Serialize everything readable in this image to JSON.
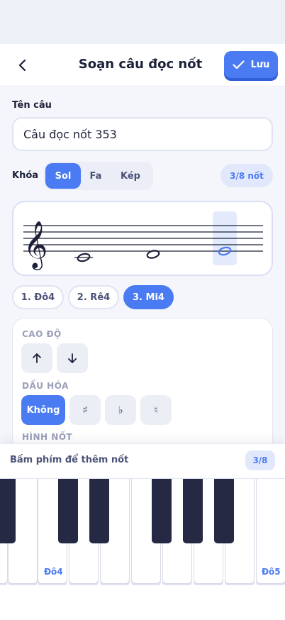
{
  "header": {
    "title": "Soạn câu đọc nốt",
    "save_label": "Lưu"
  },
  "form": {
    "name_label": "Tên câu",
    "name_value": "Câu đọc nốt 353",
    "clef_label": "Khóa",
    "clef_options": [
      "Sol",
      "Fa",
      "Kép"
    ],
    "clef_selected": "Sol",
    "note_count": "3/8 nốt"
  },
  "notes": {
    "chips": [
      "1. Đô4",
      "2. Rê4",
      "3. Mi4"
    ],
    "selected_index": 2
  },
  "editor": {
    "pitch_label": "CAO ĐỘ",
    "accidental_label": "DẤU HÓA",
    "accidental_options": [
      "Không",
      "♯",
      "♭",
      "♮"
    ],
    "accidental_selected": "Không",
    "duration_label": "HÌNH NỐT"
  },
  "keyboard": {
    "hint": "Bấm phím để thêm nốt",
    "count": "3/8",
    "key_labels": [
      "Đô4",
      "Đô5"
    ]
  },
  "colors": {
    "accent": "#4a7bf2",
    "black_key": "#252944",
    "background": "#f5f6fb"
  }
}
